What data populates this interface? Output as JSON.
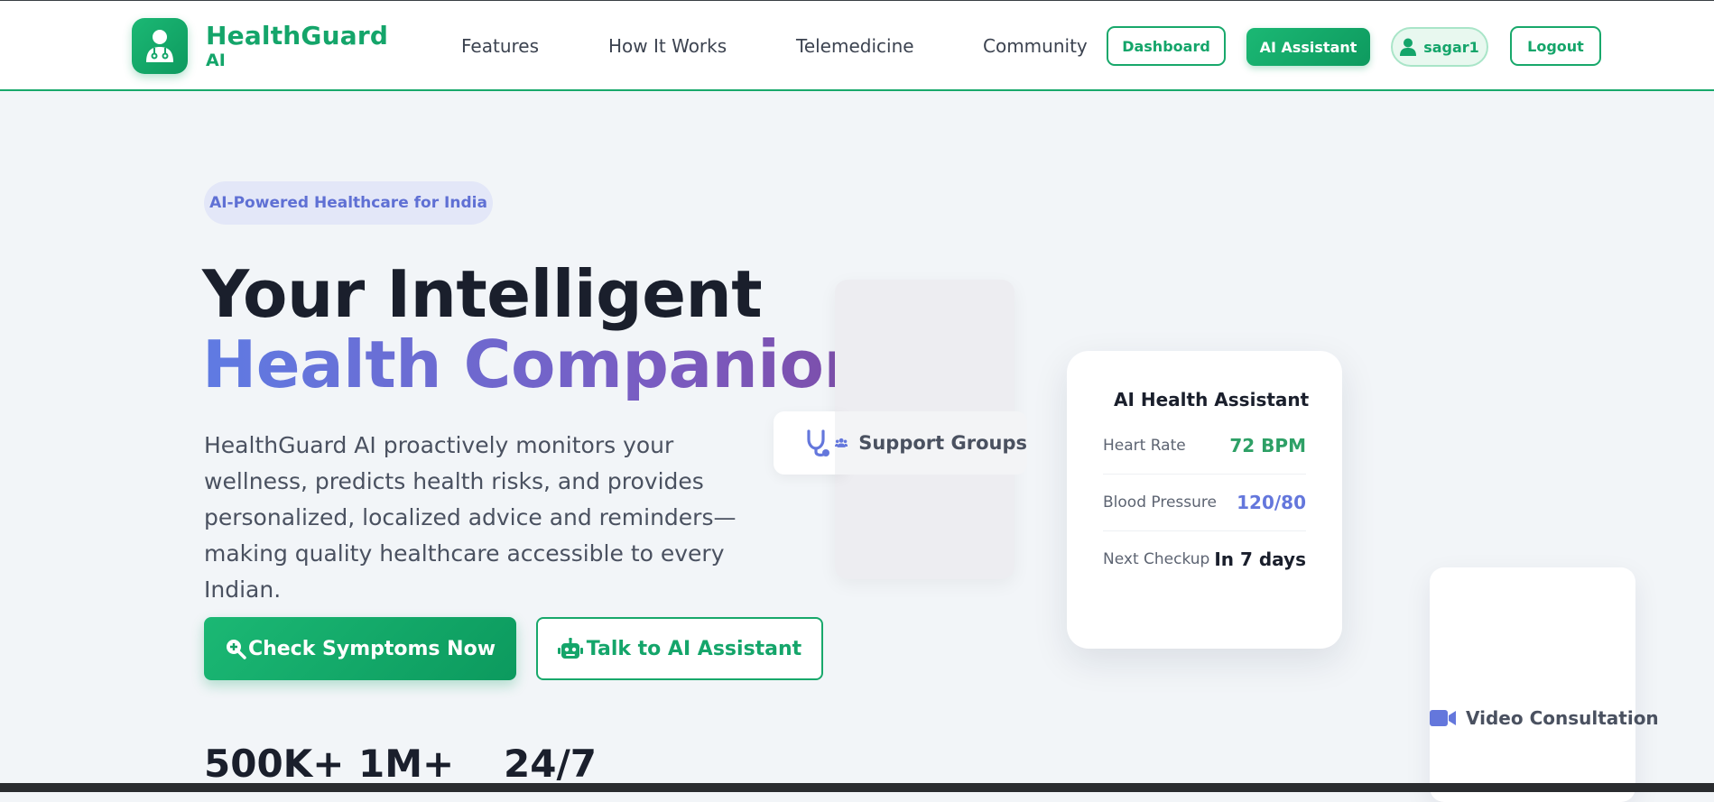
{
  "brand": {
    "name_line1": "HealthGuard",
    "name_line2": "AI",
    "logo_icon": "doctor-icon"
  },
  "nav": {
    "links": [
      "Features",
      "How It Works",
      "Telemedicine",
      "Community"
    ],
    "dashboard_label": "Dashboard",
    "ai_assistant_label": "AI Assistant",
    "user_name": "sagar1",
    "logout_label": "Logout"
  },
  "hero": {
    "badge": "AI-Powered Healthcare for India",
    "title_line1": "Your Intelligent",
    "title_line2": "Health Companion",
    "description": "HealthGuard AI proactively monitors your wellness, predicts health risks, and provides personalized, localized advice and reminders—making quality healthcare accessible to every Indian.",
    "cta_primary": "Check Symptoms Now",
    "cta_secondary": "Talk to AI Assistant",
    "stats": [
      "500K+",
      "1M+",
      "24/7"
    ]
  },
  "floating": {
    "support_groups": "Support Groups",
    "video_consultation": "Video Consultation"
  },
  "assistant_card": {
    "title": "AI Health Assistant",
    "metrics": [
      {
        "label": "Heart Rate",
        "value": "72 BPM",
        "color": "#2ea066"
      },
      {
        "label": "Blood Pressure",
        "value": "120/80",
        "color": "#6477dc"
      },
      {
        "label": "Next Checkup",
        "value": "In 7 days",
        "color": "#1a1f2c"
      }
    ]
  },
  "colors": {
    "brand_green": "#14a56a",
    "accent_indigo": "#6477dc",
    "accent_purple": "#7d4da8"
  }
}
